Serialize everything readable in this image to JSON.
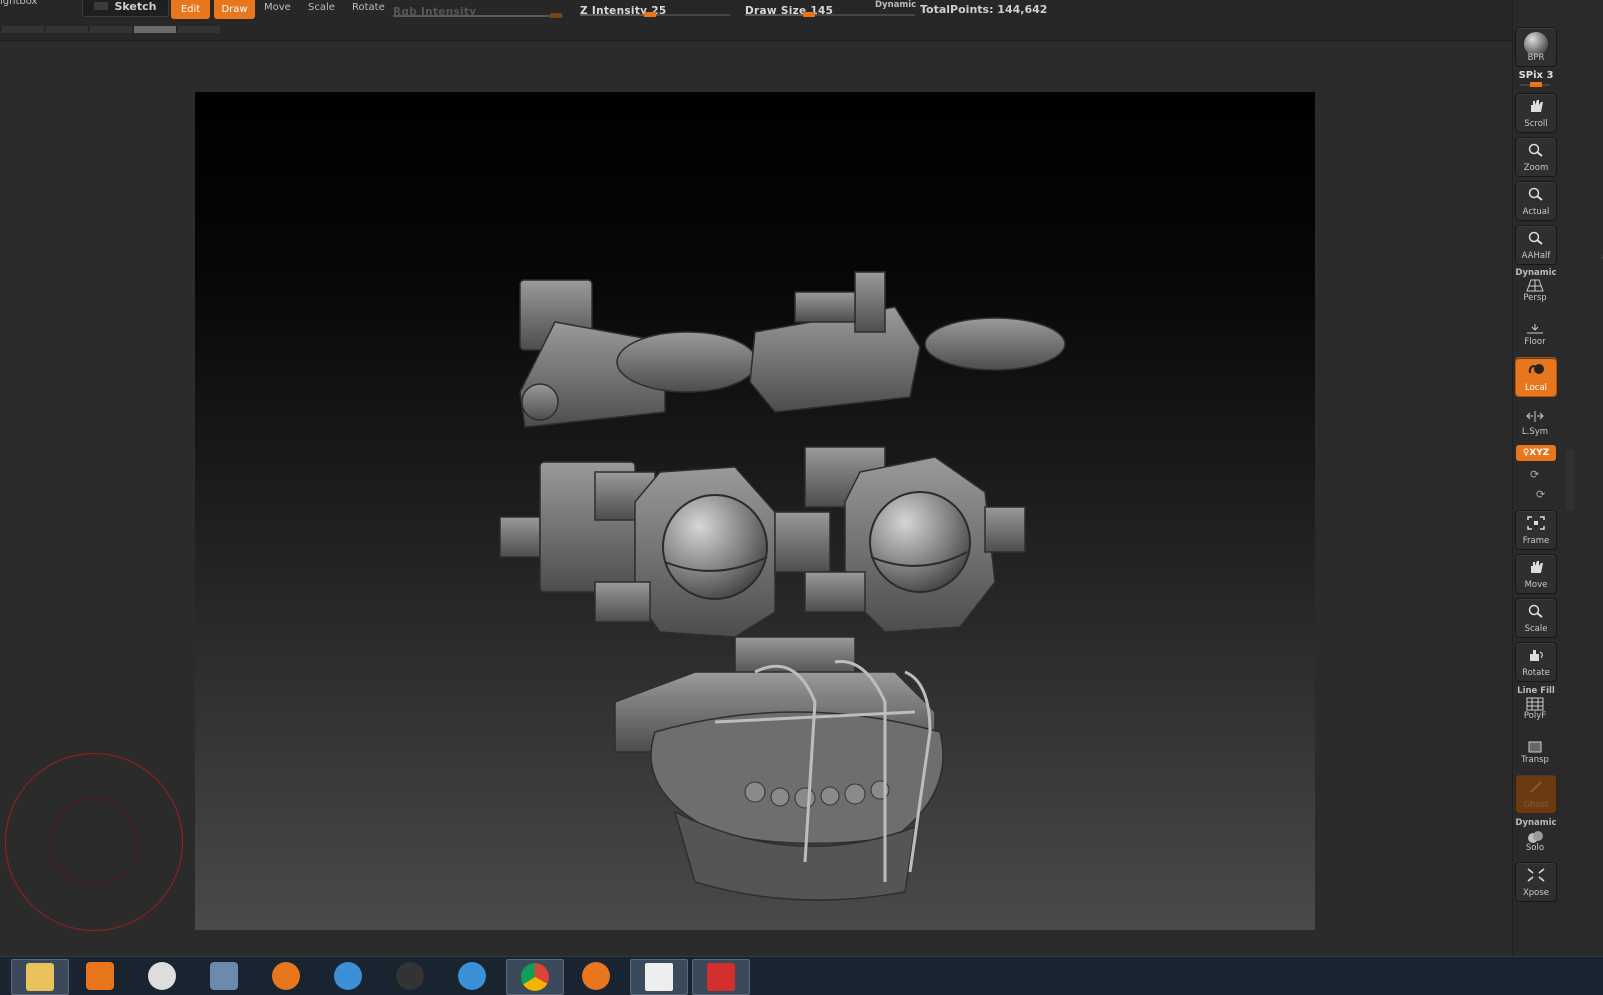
{
  "toolbar": {
    "lightbox": "ightbox",
    "sketch": "Sketch",
    "edit": "Edit",
    "draw": "Draw",
    "move": "Move",
    "scale": "Scale",
    "rotate": "Rotate",
    "rgb_intensity": "Rgb Intensity",
    "z_intensity": "Z Intensity 25",
    "z_intensity_value": 25,
    "draw_size": "Draw Size 145",
    "draw_size_value": 145,
    "dynamic": "Dynamic",
    "total_points": "TotalPoints: 144,642"
  },
  "shelf": {
    "bpr": "BPR",
    "spix": "SPix 3",
    "scroll": "Scroll",
    "zoom": "Zoom",
    "actual": "Actual",
    "aahalf": "AAHalf",
    "dynamic_persp": "Dynamic",
    "persp": "Persp",
    "floor": "Floor",
    "local": "Local",
    "lsym": "L.Sym",
    "xyz": "♀XYZ",
    "frame": "Frame",
    "move": "Move",
    "scale": "Scale",
    "rotate": "Rotate",
    "line_fill": "Line Fill",
    "polyf": "PolyF",
    "transp": "Transp",
    "ghost": "Ghost",
    "dynamic_solo": "Dynamic",
    "solo": "Solo",
    "xpose": "Xpose"
  },
  "colors": {
    "accent": "#e8761c",
    "panel": "#2b2b2b",
    "brush_ring": "#a51d1d"
  },
  "taskbar": {
    "apps": [
      "file-explorer-icon",
      "media-player-icon",
      "steam-icon",
      "image-app-icon",
      "blender-icon",
      "keyshot-icon",
      "brush-app-icon",
      "keyshot-icon",
      "chrome-icon",
      "firefox-icon",
      "zbrush-icon",
      "sketchup-icon"
    ]
  }
}
